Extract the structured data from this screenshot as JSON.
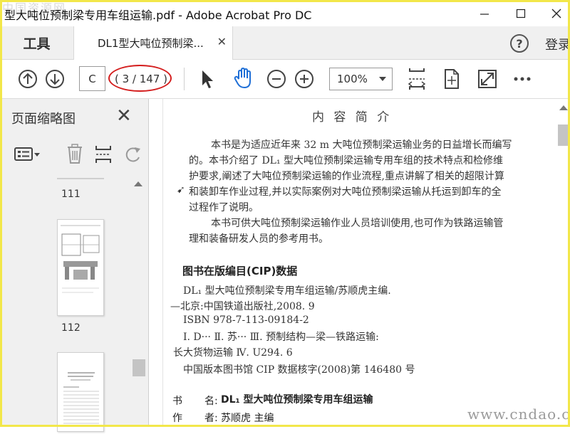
{
  "window": {
    "title": "型大吨位预制梁专用车组运输.pdf - Adobe Acrobat Pro DC",
    "watermark_top": "中国资源网",
    "minimize_icon": "minimize-icon",
    "maximize_icon": "maximize-icon",
    "close_icon": "close-icon"
  },
  "tabs": {
    "tools_label": "工具",
    "doc_label": "DL1型大吨位预制梁...",
    "help_label": "?",
    "login_label": "登录"
  },
  "toolbar": {
    "page_input_value": "C",
    "page_count": "( 3 / 147 )",
    "zoom_value": "100%",
    "annotation_color": "#d41e1e",
    "icons": [
      "prev-page-icon",
      "next-page-icon",
      "select-arrow-icon",
      "hand-icon",
      "zoom-out-icon",
      "zoom-in-icon",
      "fit-page-icon",
      "rotate-view-icon",
      "full-screen-icon",
      "more-icon"
    ]
  },
  "left_panel": {
    "title": "页面缩略图",
    "thumbnails": [
      {
        "label": "111"
      },
      {
        "label": "112"
      }
    ]
  },
  "document": {
    "heading": "内 容 简 介",
    "paragraph1_lines": [
      "本书是为适应近年来 32 m 大吨位预制梁运输业务的日益增长而编写",
      "的。本书介绍了 DL₁ 型大吨位预制梁运输专用车组的技术特点和检修维",
      "护要求,阐述了大吨位预制梁运输的作业流程,重点讲解了相关的超限计算",
      "和装卸车作业过程,并以实际案例对大吨位预制梁运输从托运到卸车的全",
      "过程作了说明。"
    ],
    "paragraph2_lines": [
      "本书可供大吨位预制梁运输作业人员培训使用,也可作为铁路运输管",
      "理和装备研发人员的参考用书。"
    ],
    "cip_heading": "图书在版编目(CIP)数据",
    "cip_lines": [
      "DL₁ 型大吨位预制梁专用车组运输/苏顺虎主编.",
      "—北京:中国铁道出版社,2008. 9",
      "ISBN 978-7-113-09184-2",
      "Ⅰ. D···   Ⅱ. 苏···   Ⅲ. 预制结构—梁—铁路运输:",
      "长大货物运输   Ⅳ. U294. 6",
      "中国版本图书馆 CIP 数据核字(2008)第 146480 号"
    ],
    "book_title_label": "书",
    "book_title_key": "名:",
    "book_title_value": "DL₁ 型大吨位预制梁专用车组运输",
    "author_label": "作",
    "author_key": "者:",
    "author_value": "苏顺虎  主编",
    "watermark_bottom": "www.cndao.com"
  }
}
